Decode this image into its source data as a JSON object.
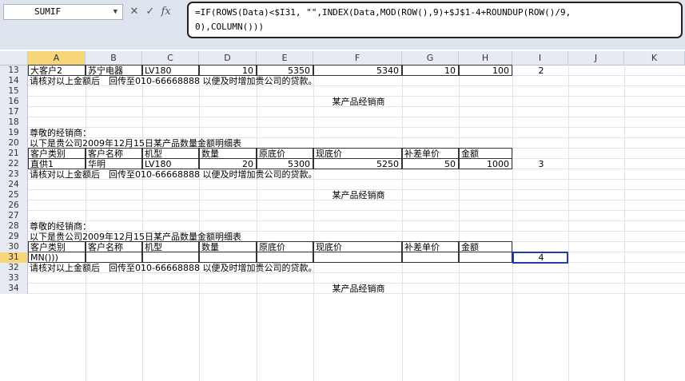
{
  "formula_bar": {
    "name_box": "SUMIF",
    "cancel_icon": "✕",
    "enter_icon": "✓",
    "fx_label": "fx",
    "formula_line1": "=IF(ROWS(Data)<$I31, \"\",INDEX(Data,MOD(ROW(),9)+$J$1-4+ROUNDUP(ROW()/9,",
    "formula_line2": "0),COLUMN()))"
  },
  "columns": [
    "A",
    "B",
    "C",
    "D",
    "E",
    "F",
    "G",
    "H",
    "I",
    "J",
    "K"
  ],
  "selected_column": "A",
  "rows": [
    {
      "n": "13",
      "cells": {
        "A": "大客户2",
        "B": "苏宁电器",
        "C": "LV180",
        "D": "10",
        "E": "5350",
        "F": "5340",
        "G": "10",
        "H": "100",
        "I": "2"
      }
    },
    {
      "n": "14",
      "cells": {
        "A": "请核对以上金额后　回传至010-66668888 以便及时增加贵公司的贷款。"
      }
    },
    {
      "n": "15",
      "cells": {}
    },
    {
      "n": "16",
      "cells": {
        "F": "某产品经销商"
      }
    },
    {
      "n": "17",
      "cells": {}
    },
    {
      "n": "18",
      "cells": {}
    },
    {
      "n": "19",
      "cells": {
        "A": "尊敬的经销商："
      }
    },
    {
      "n": "20",
      "cells": {
        "A": "以下是贵公司2009年12月15日某产品数量金额明细表"
      }
    },
    {
      "n": "21",
      "cells": {
        "A": "客户类别",
        "B": "客户名称",
        "C": "机型",
        "D": "数量",
        "E": "原底价",
        "F": "现底价",
        "G": "补差单价",
        "H": "金额"
      }
    },
    {
      "n": "22",
      "cells": {
        "A": "直供1",
        "B": "华明",
        "C": "LV180",
        "D": "20",
        "E": "5300",
        "F": "5250",
        "G": "50",
        "H": "1000",
        "I": "3"
      }
    },
    {
      "n": "23",
      "cells": {
        "A": "请核对以上金额后　回传至010-66668888 以便及时增加贵公司的贷款。"
      }
    },
    {
      "n": "24",
      "cells": {}
    },
    {
      "n": "25",
      "cells": {
        "F": "某产品经销商"
      }
    },
    {
      "n": "26",
      "cells": {}
    },
    {
      "n": "27",
      "cells": {}
    },
    {
      "n": "28",
      "cells": {
        "A": "尊敬的经销商："
      }
    },
    {
      "n": "29",
      "cells": {
        "A": "以下是贵公司2009年12月15日某产品数量金额明细表"
      }
    },
    {
      "n": "30",
      "cells": {
        "A": "客户类别",
        "B": "客户名称",
        "C": "机型",
        "D": "数量",
        "E": "原底价",
        "F": "现底价",
        "G": "补差单价",
        "H": "金额"
      }
    },
    {
      "n": "31",
      "cells": {
        "A": "MN()))",
        "I": "4"
      }
    },
    {
      "n": "32",
      "cells": {
        "A": "请核对以上金额后　回传至010-66668888 以便及时增加贵公司的贷款。"
      }
    },
    {
      "n": "33",
      "cells": {}
    },
    {
      "n": "34",
      "cells": {
        "F": "某产品经销商"
      }
    }
  ],
  "selected_row": "31",
  "colors": {
    "accent": "#1c3fa8",
    "header_bg": "#e6ebf2",
    "header_sel": "#f7d67a"
  }
}
